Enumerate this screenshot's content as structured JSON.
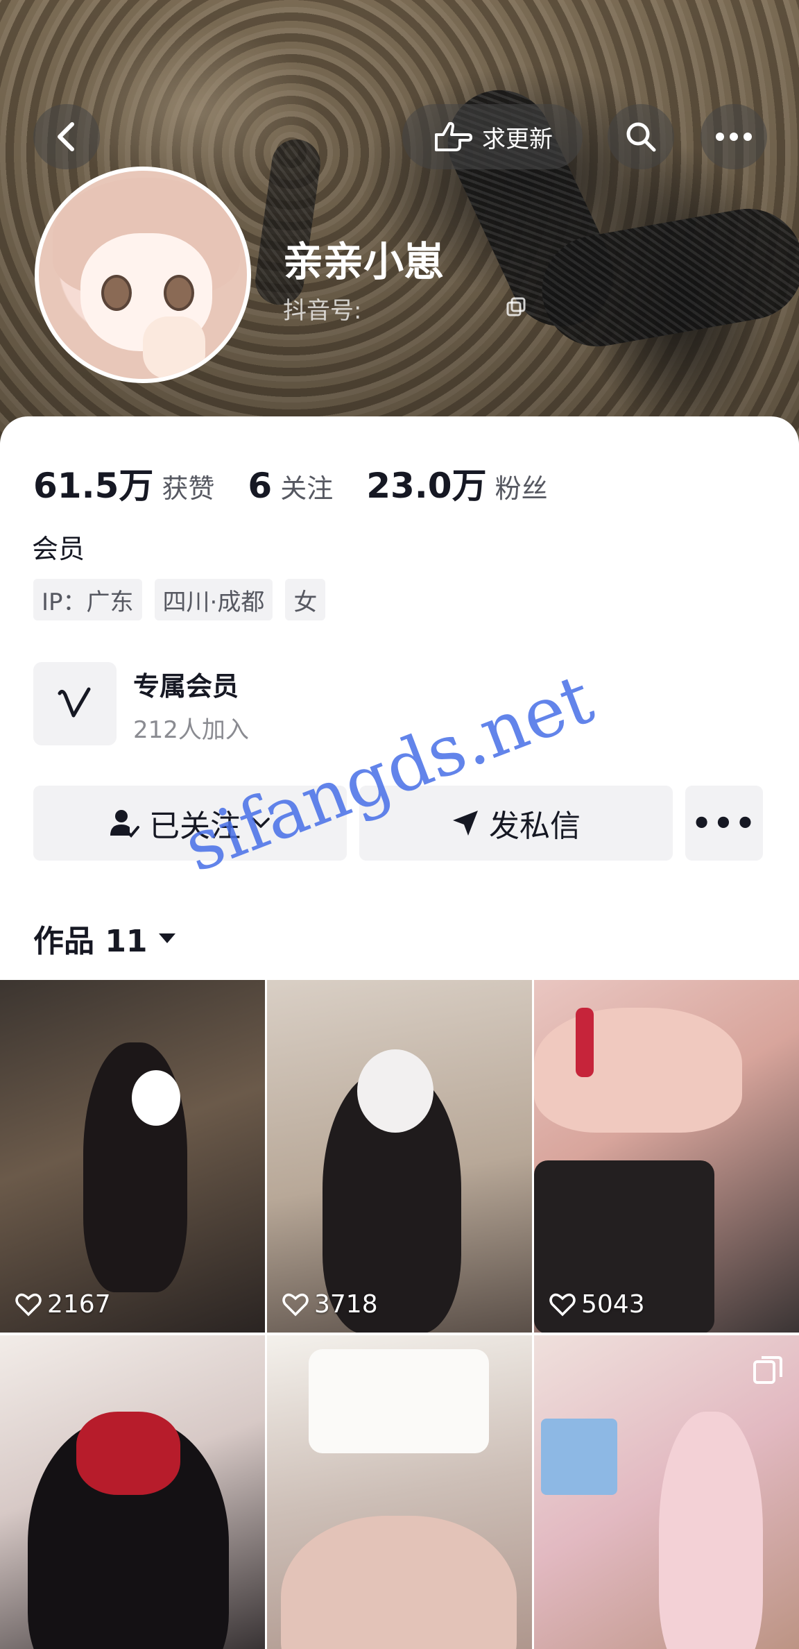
{
  "header": {
    "update_button_label": "求更新",
    "profile_name": "亲亲小崽",
    "douyin_id_label": "抖音号:",
    "douyin_id_value": ""
  },
  "stats": [
    {
      "value": "61.5万",
      "label": "获赞"
    },
    {
      "value": "6",
      "label": "关注"
    },
    {
      "value": "23.0万",
      "label": "粉丝"
    }
  ],
  "bio": {
    "member_text": "会员",
    "tags": [
      "IP：广东",
      "四川·成都",
      "女"
    ]
  },
  "vip": {
    "title": "专属会员",
    "count": "212人加入"
  },
  "actions": {
    "follow_label": "已关注",
    "message_label": "发私信",
    "more_label": "•••"
  },
  "works": {
    "tab_label": "作品 11",
    "items": [
      {
        "likes": "2167"
      },
      {
        "likes": "3718"
      },
      {
        "likes": "5043"
      },
      {
        "likes": ""
      },
      {
        "likes": ""
      },
      {
        "likes": ""
      }
    ]
  },
  "watermark": "sifangds.net",
  "colors": {
    "text_primary": "#161823",
    "text_secondary": "#565861",
    "chip_bg": "#f2f2f4",
    "watermark": "#466ee6"
  }
}
